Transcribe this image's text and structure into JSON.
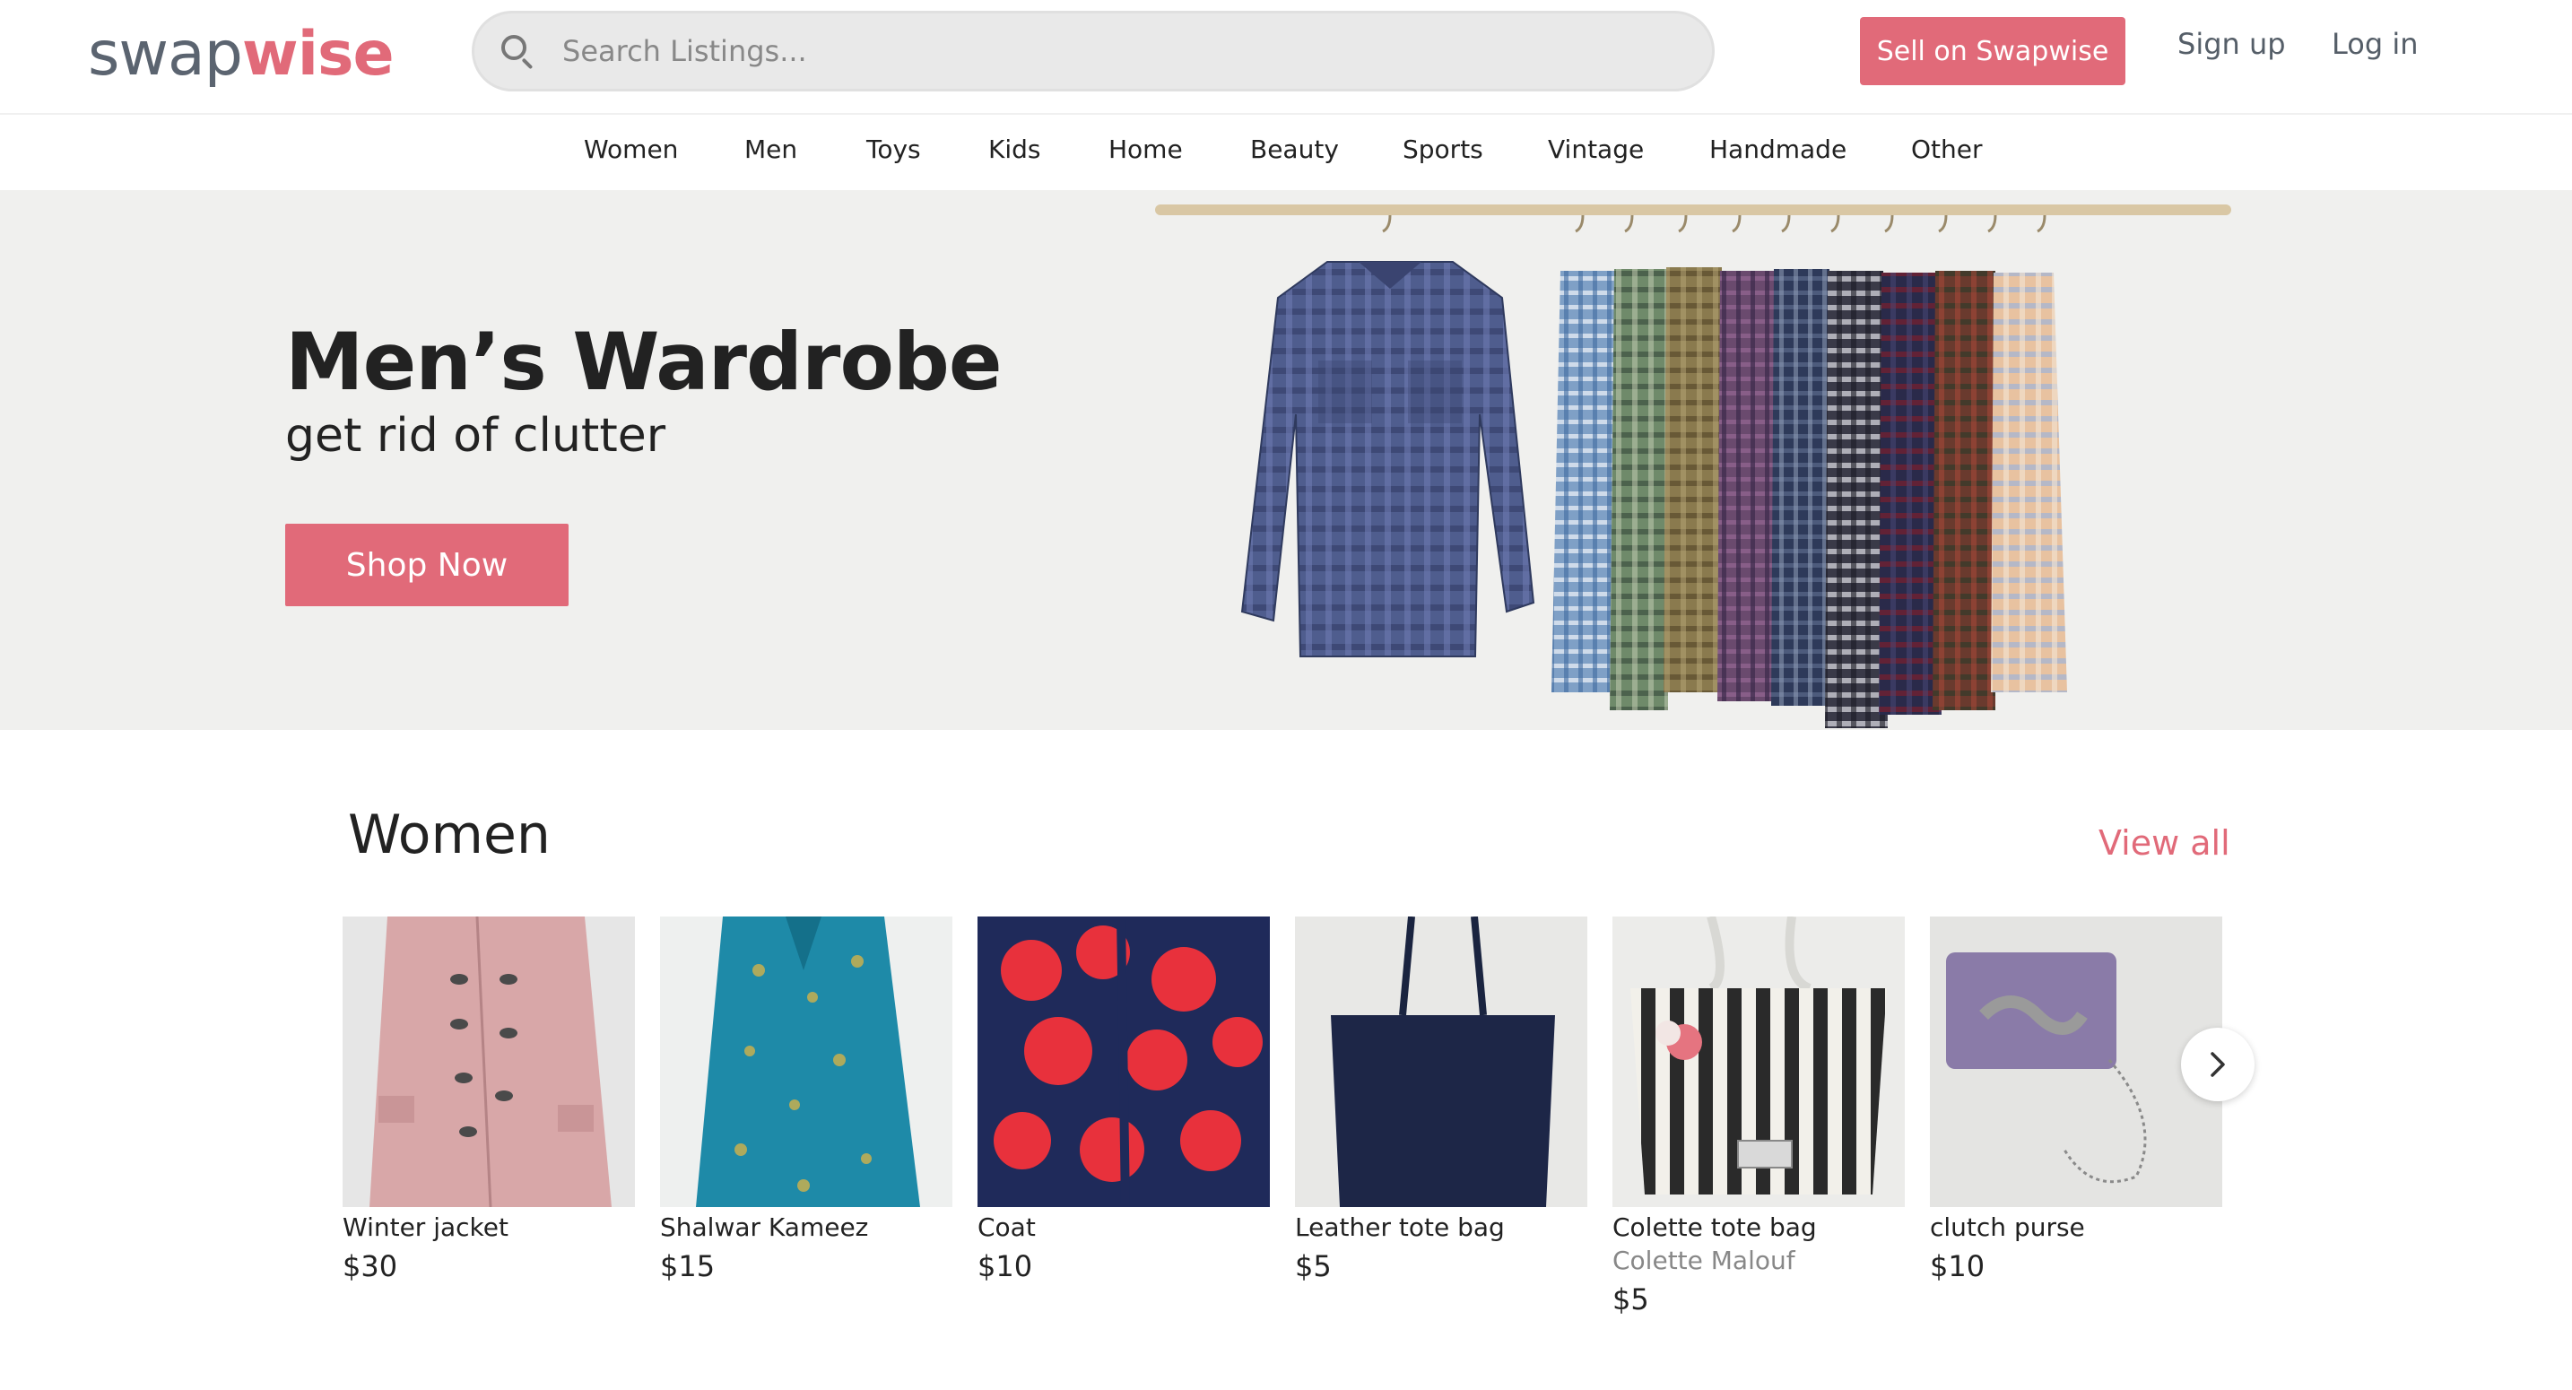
{
  "header": {
    "logo_part1": "swap",
    "logo_part2": "wise",
    "search_placeholder": "Search Listings...",
    "sell_label": "Sell on Swapwise",
    "signup_label": "Sign up",
    "login_label": "Log in"
  },
  "nav": {
    "items": [
      "Women",
      "Men",
      "Toys",
      "Kids",
      "Home",
      "Beauty",
      "Sports",
      "Vintage",
      "Handmade",
      "Other"
    ]
  },
  "hero": {
    "title": "Men’s Wardrobe",
    "subtitle": "get rid of clutter",
    "cta_label": "Shop Now"
  },
  "section": {
    "title": "Women",
    "view_all_label": "View all",
    "products": [
      {
        "name": "Winter jacket",
        "brand": "",
        "price": "$30"
      },
      {
        "name": "Shalwar Kameez",
        "brand": "",
        "price": "$15"
      },
      {
        "name": "Coat",
        "brand": "",
        "price": "$10"
      },
      {
        "name": "Leather tote bag",
        "brand": "",
        "price": "$5"
      },
      {
        "name": "Colette tote bag",
        "brand": "Colette Malouf",
        "price": "$5"
      },
      {
        "name": "clutch purse",
        "brand": "",
        "price": "$10"
      }
    ]
  },
  "colors": {
    "accent": "#e16a79",
    "logo_gray": "#5b6470",
    "hero_bg": "#f0f0ee",
    "search_bg": "#e9e9e9"
  },
  "icons": {
    "search": "search-icon",
    "next": "chevron-right-icon"
  }
}
